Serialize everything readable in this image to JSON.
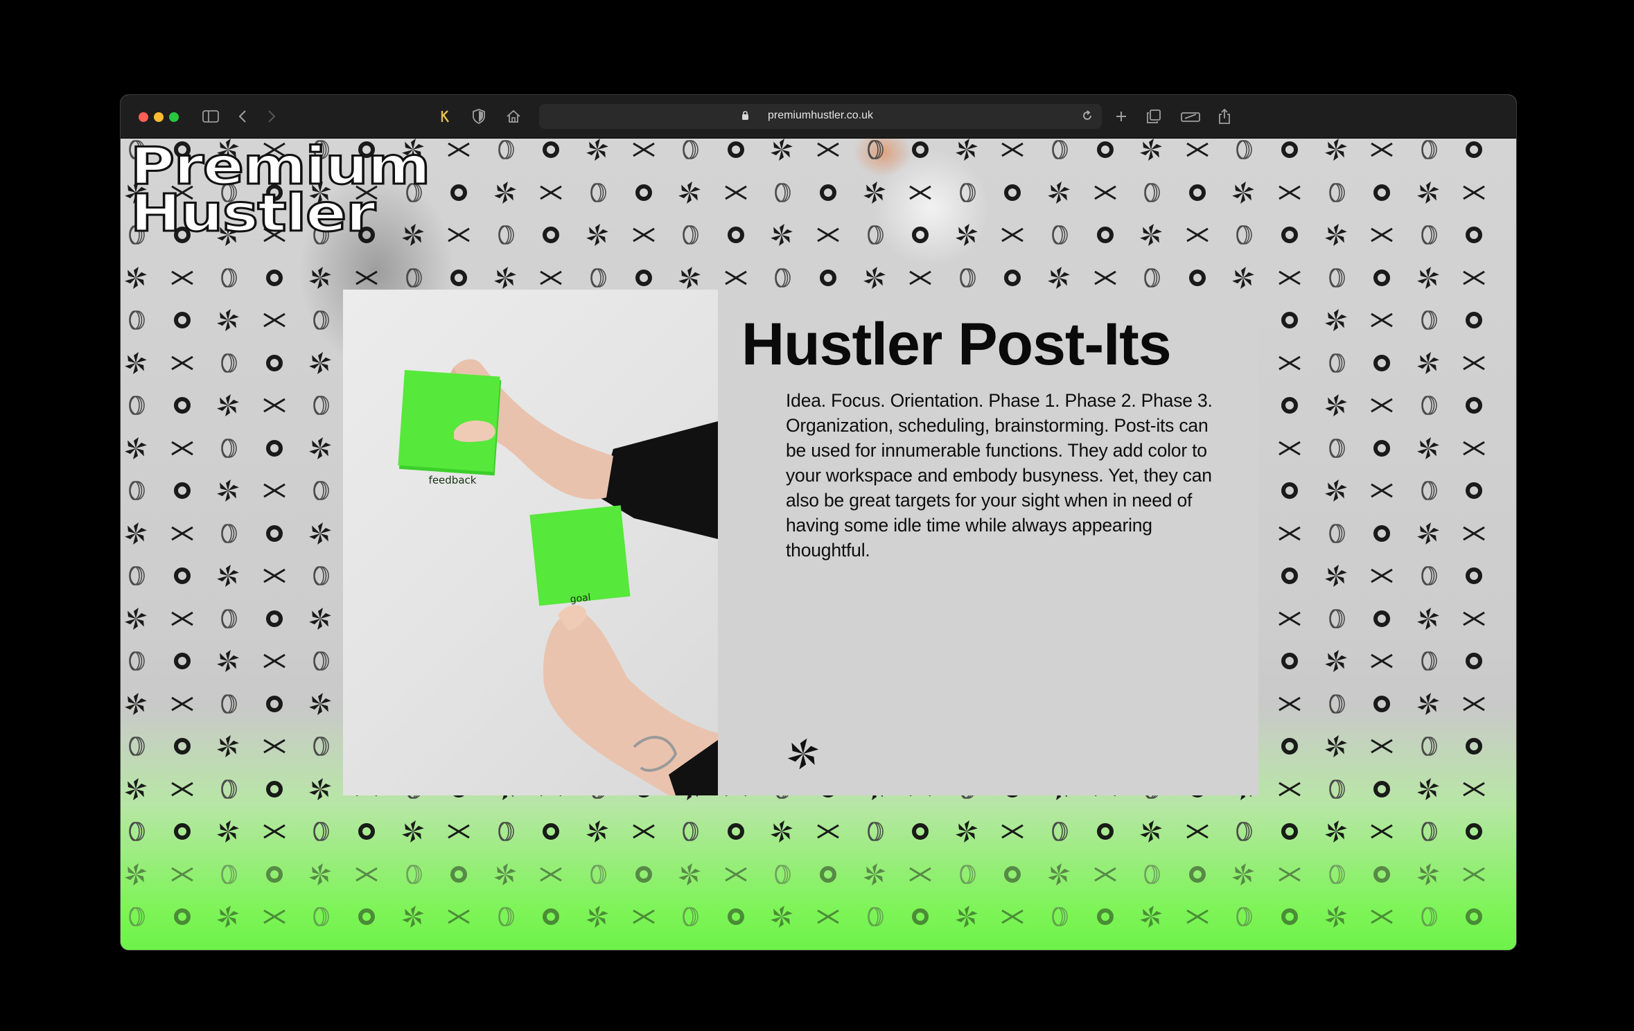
{
  "browser": {
    "url": "premiumhustler.co.uk",
    "icons": [
      "sidebar-icon",
      "back-icon",
      "forward-icon",
      "extension-icon",
      "shield-icon",
      "home-icon",
      "lock-icon",
      "reload-icon",
      "new-tab-icon",
      "tabs-icon",
      "reader-icon",
      "share-icon"
    ]
  },
  "site": {
    "logo_line1": "Premium",
    "logo_line2": "Hustler"
  },
  "product": {
    "title": "Hustler Post-Its",
    "description": "Idea. Focus. Orientation. Phase 1. Phase 2. Phase 3. Organization, scheduling, brainstorming. Post-its can be used for innumerable functions. They add color to your workspace and embody busyness. Yet, they can also be great targets for your sight when in need of having some idle time while always appearing thoughtful.",
    "note1": "feedback",
    "note2": "goal",
    "accent": "#6ef24a"
  }
}
